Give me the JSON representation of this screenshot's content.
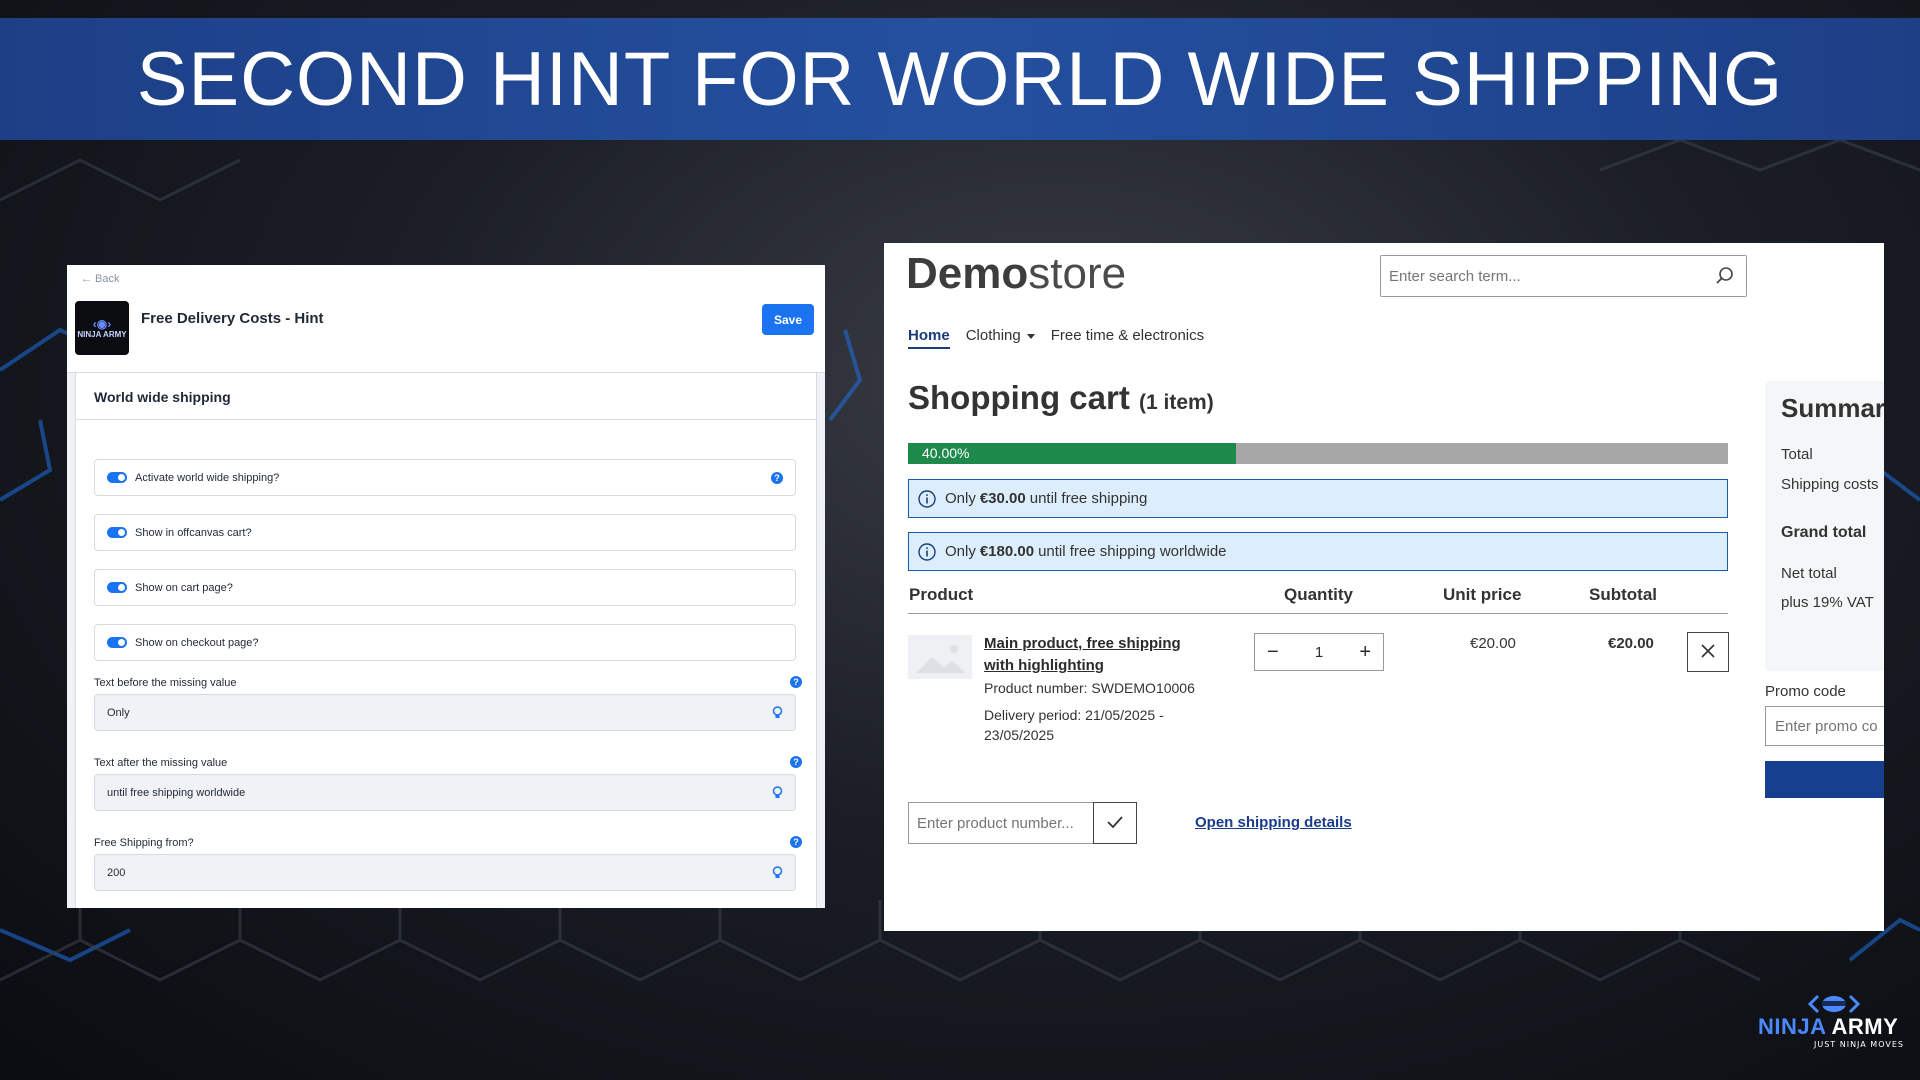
{
  "banner": {
    "title": "SECOND HINT FOR WORLD WIDE SHIPPING"
  },
  "admin": {
    "back_label": "← Back",
    "logo_text": "NINJA ARMY",
    "title": "Free Delivery Costs - Hint",
    "save_label": "Save",
    "card_title": "World wide shipping",
    "switches": [
      {
        "label": "Activate world wide shipping?",
        "on": true
      },
      {
        "label": "Show in offcanvas cart?",
        "on": true
      },
      {
        "label": "Show on cart page?",
        "on": true
      },
      {
        "label": "Show on checkout page?",
        "on": true
      }
    ],
    "fields": [
      {
        "label": "Text before the missing value",
        "value": "Only"
      },
      {
        "label": "Text after the missing value",
        "value": "until free shipping worldwide"
      },
      {
        "label": "Free Shipping from?",
        "value": "200"
      }
    ],
    "accent_color": "#1a73f0"
  },
  "store": {
    "logo_bold": "Demo",
    "logo_light": "store",
    "search_placeholder": "Enter search term...",
    "nav": [
      "Home",
      "Clothing",
      "Free time & electronics"
    ],
    "cart_title": "Shopping cart",
    "cart_count": "(1 item)",
    "progress_label": "40.00%",
    "progress_value": 0.4,
    "notices": [
      {
        "prefix": "Only",
        "amount": "€30.00",
        "suffix": "until free shipping"
      },
      {
        "prefix": "Only",
        "amount": "€180.00",
        "suffix": "until free shipping worldwide"
      }
    ],
    "table_headers": [
      "Product",
      "Quantity",
      "Unit price",
      "Subtotal"
    ],
    "item": {
      "name": "Main product, free shipping with highlighting",
      "product_number": "Product number: SWDEMO10006",
      "delivery": "Delivery period: 21/05/2025 - 23/05/2025",
      "quantity": "1",
      "unit_price": "€20.00",
      "subtotal": "€20.00"
    },
    "summary": {
      "title": "Summar",
      "total": "Total",
      "shipping": "Shipping costs",
      "grand_total": "Grand total",
      "net_total": "Net total",
      "vat": "plus 19% VAT"
    },
    "promo_label": "Promo code",
    "promo_placeholder": "Enter promo co",
    "product_number_placeholder": "Enter product number...",
    "shipping_link": "Open shipping details",
    "progress_color": "#1d8a4c"
  },
  "brand": {
    "name_a": "NINJA",
    "name_b": "ARMY",
    "tagline": "JUST NINJA MOVES"
  }
}
